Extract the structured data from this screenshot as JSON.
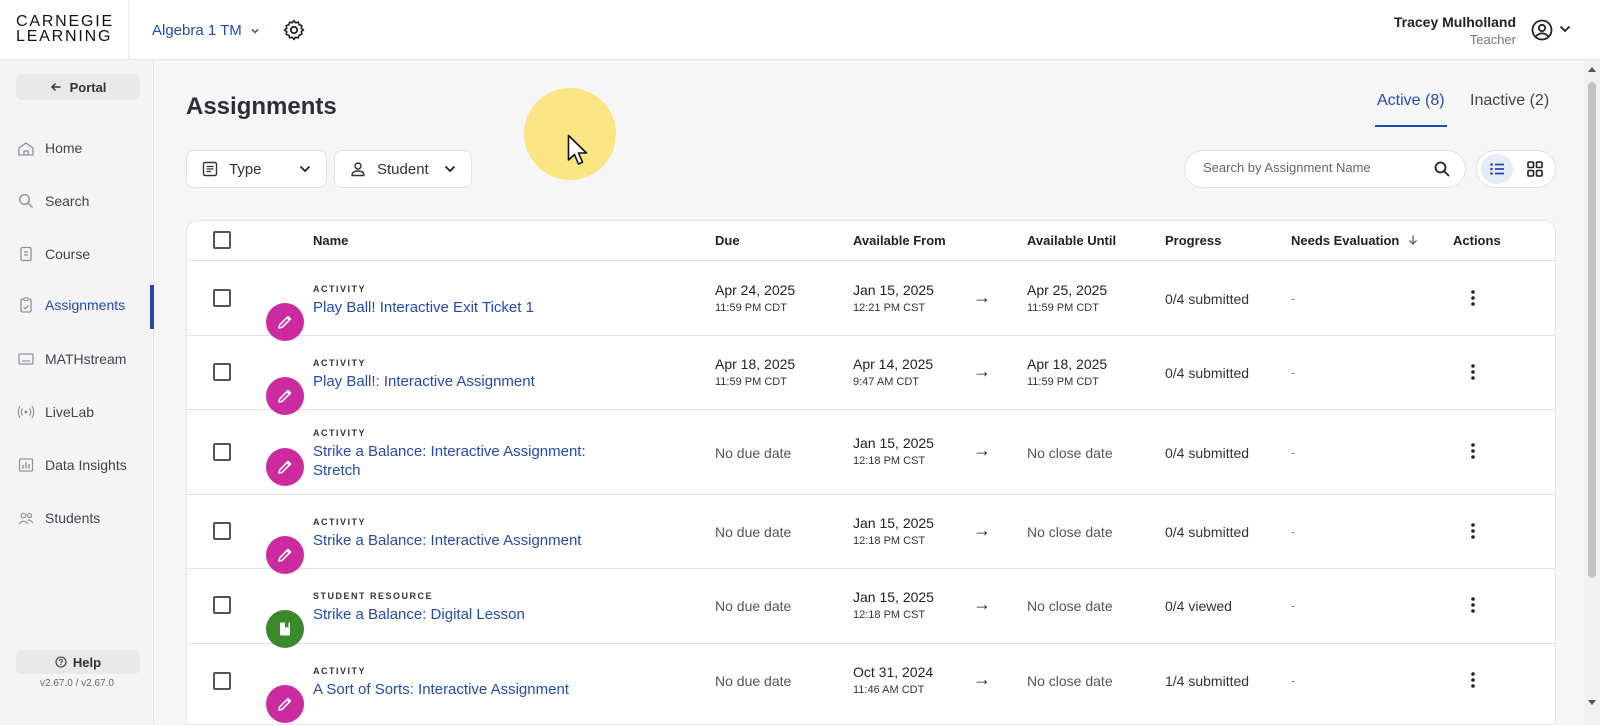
{
  "header": {
    "logo_line1": "CARNEGIE",
    "logo_line2": "LEARNING",
    "course": "Algebra 1 TM",
    "user_name": "Tracey Mulholland",
    "user_role": "Teacher"
  },
  "sidebar": {
    "portal_label": "Portal",
    "items": [
      {
        "label": "Home",
        "icon": "school-icon"
      },
      {
        "label": "Search",
        "icon": "search-icon"
      },
      {
        "label": "Course",
        "icon": "course-book-icon"
      },
      {
        "label": "Assignments",
        "icon": "assignment-icon"
      },
      {
        "label": "MATHstream",
        "icon": "video-icon"
      },
      {
        "label": "LiveLab",
        "icon": "broadcast-icon"
      },
      {
        "label": "Data Insights",
        "icon": "chart-icon"
      },
      {
        "label": "Students",
        "icon": "people-icon"
      }
    ],
    "help_label": "Help",
    "version": "v2.67.0 / v2.67.0"
  },
  "main": {
    "title": "Assignments",
    "tabs": [
      {
        "label": "Active (8)"
      },
      {
        "label": "Inactive (2)"
      }
    ],
    "filters": {
      "type_label": "Type",
      "student_label": "Student"
    },
    "search": {
      "placeholder": "Search by Assignment Name"
    }
  },
  "table": {
    "columns": [
      "Name",
      "Due",
      "Available From",
      "Available Until",
      "Progress",
      "Needs Evaluation",
      "Actions"
    ],
    "rows": [
      {
        "type": "ACTIVITY",
        "name": "Play Ball! Interactive Exit Ticket 1",
        "due": "Apr 24, 2025",
        "due_time": "11:59 PM CDT",
        "from": "Jan 15, 2025",
        "from_time": "12:21 PM CST",
        "until": "Apr 25, 2025",
        "until_time": "11:59 PM CDT",
        "progress": "0/4 submitted",
        "needs": "-"
      },
      {
        "type": "ACTIVITY",
        "name": "Play Ball!: Interactive Assignment",
        "due": "Apr 18, 2025",
        "due_time": "11:59 PM CDT",
        "from": "Apr 14, 2025",
        "from_time": "9:47 AM CDT",
        "until": "Apr 18, 2025",
        "until_time": "11:59 PM CDT",
        "progress": "0/4 submitted",
        "needs": "-"
      },
      {
        "type": "ACTIVITY",
        "name": "Strike a Balance: Interactive Assignment: Stretch",
        "due": "No due date",
        "from": "Jan 15, 2025",
        "from_time": "12:18 PM CST",
        "until": "No close date",
        "progress": "0/4 submitted",
        "needs": "-"
      },
      {
        "type": "ACTIVITY",
        "name": "Strike a Balance: Interactive Assignment",
        "due": "No due date",
        "from": "Jan 15, 2025",
        "from_time": "12:18 PM CST",
        "until": "No close date",
        "progress": "0/4 submitted",
        "needs": "-"
      },
      {
        "type": "STUDENT RESOURCE",
        "name": "Strike a Balance: Digital Lesson",
        "due": "No due date",
        "from": "Jan 15, 2025",
        "from_time": "12:18 PM CST",
        "until": "No close date",
        "progress": "0/4 viewed",
        "needs": "-"
      },
      {
        "type": "ACTIVITY",
        "name": "A Sort of Sorts: Interactive Assignment",
        "due": "No due date",
        "from": "Oct 31, 2024",
        "from_time": "11:46 AM CDT",
        "until": "No close date",
        "progress": "1/4 submitted",
        "needs": "-"
      }
    ]
  },
  "colors": {
    "accent": "#2349b5",
    "activity_badge": "#cc2a9f",
    "resource_badge": "#3a8a2b"
  }
}
